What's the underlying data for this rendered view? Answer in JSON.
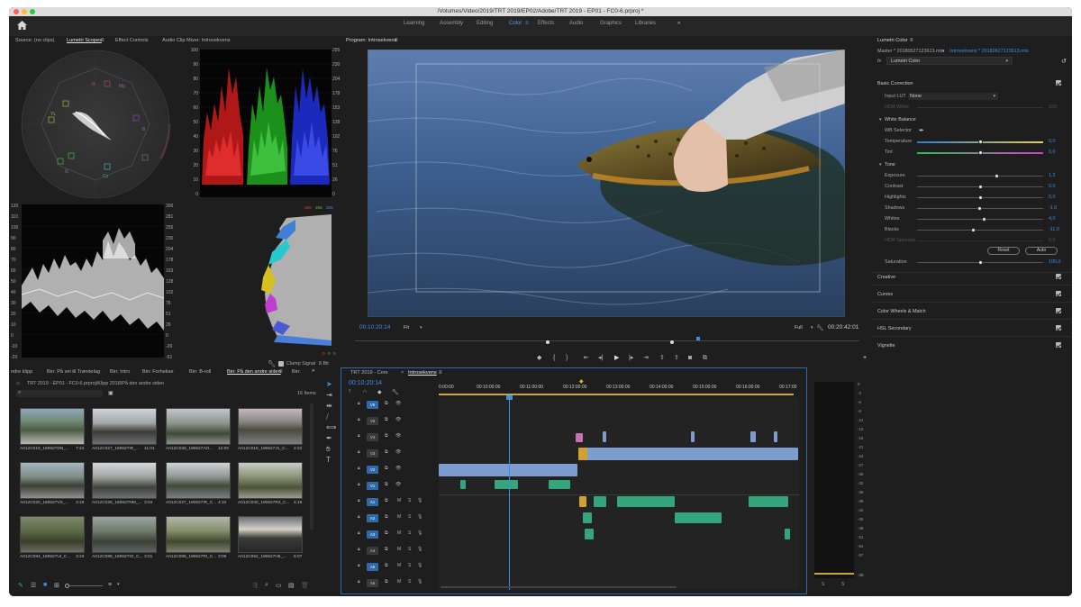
{
  "window": {
    "title": "/Volumes/Video/2019/TRT 2019/EP02/Adobe/TRT 2019 - EP01 - FC0-6.prproj *"
  },
  "workspaces": [
    {
      "label": "Learning",
      "active": false
    },
    {
      "label": "Assembly",
      "active": false
    },
    {
      "label": "Editing",
      "active": false
    },
    {
      "label": "Color",
      "active": true
    },
    {
      "label": "Effects",
      "active": false
    },
    {
      "label": "Audio",
      "active": false
    },
    {
      "label": "Graphics",
      "active": false
    },
    {
      "label": "Libraries",
      "active": false
    }
  ],
  "source_panel": {
    "tabs": [
      "Source: (no clips)",
      "Lumetri Scopes",
      "Effect Controls",
      "Audio Clip Mixer: Introsekvens"
    ],
    "active_tab": "Lumetri Scopes",
    "vectorscope_labels": [
      "R",
      "Mg",
      "B",
      "Cy",
      "G",
      "YL"
    ],
    "parade_scale": [
      "100",
      "90",
      "80",
      "70",
      "60",
      "50",
      "40",
      "30",
      "20",
      "10",
      "0"
    ],
    "parade_right_scale": [
      "255",
      "230",
      "204",
      "178",
      "153",
      "128",
      "102",
      "76",
      "51",
      "26",
      "0"
    ],
    "waveform_scale": [
      "120",
      "110",
      "100",
      "90",
      "80",
      "70",
      "60",
      "50",
      "40",
      "30",
      "20",
      "10",
      "0",
      "-10",
      "-20"
    ],
    "waveform_right_scale": [
      "306",
      "281",
      "255",
      "230",
      "204",
      "178",
      "153",
      "128",
      "102",
      "76",
      "51",
      "26",
      "0",
      "-26",
      "-51"
    ],
    "histogram_counts": [
      "255",
      "255",
      "255"
    ],
    "histogram_bottom": [
      "0",
      "0",
      "0"
    ],
    "clamp_label": "Clamp Signal",
    "bit_depth": "8 Bit"
  },
  "program": {
    "tab": "Program: Introsekvens",
    "timecode": "00:10:20:14",
    "fit": "Fit",
    "quality": "Full",
    "duration": "00:20:42:01"
  },
  "lumetri": {
    "tab": "Lumetri Color",
    "master_clip": "Master * 20180627123613.mts",
    "seq_clip": "Introsekvens * 20180627123613.mts",
    "fx_label": "Lumetri Color",
    "basic_correction": "Basic Correction",
    "input_lut_label": "Input LUT",
    "input_lut_value": "None",
    "hdr_white_label": "HDR White",
    "hdr_white_value": "100",
    "white_balance": "White Balance",
    "wb_selector": "WB Selector",
    "temperature_label": "Temperature",
    "temperature_value": "0,0",
    "tint_label": "Tint",
    "tint_value": "0,0",
    "tone": "Tone",
    "exposure_label": "Exposure",
    "exposure_value": "1,2",
    "contrast_label": "Contrast",
    "contrast_value": "0,0",
    "highlights_label": "Highlights",
    "highlights_value": "0,0",
    "shadows_label": "Shadows",
    "shadows_value": "-1,0",
    "whites_label": "Whites",
    "whites_value": "4,0",
    "blacks_label": "Blacks",
    "blacks_value": "-11,0",
    "hdr_specular_label": "HDR Specular",
    "hdr_specular_value": "0,0",
    "reset_label": "Reset",
    "auto_label": "Auto",
    "saturation_label": "Saturation",
    "saturation_value": "100,0",
    "sections": [
      "Creative",
      "Curves",
      "Color Wheels & Match",
      "HSL Secondary",
      "Vignette"
    ]
  },
  "project": {
    "tabs": [
      "ndre klipp",
      "Bin: På vei til Trøndelag",
      "Bin: Intro",
      "Bin: Forhekse",
      "Bin: B-roll",
      "Bin: På den andre siden",
      "Bin:"
    ],
    "active_tab": "Bin: På den andre siden",
    "path": "TRT 2019 - EP01 - FC0-6.prproj\\Klipp 2018\\På den andre siden",
    "item_count": "16 Items",
    "clips": [
      {
        "name": "A012C019_180627DN_...",
        "dur": "7:24"
      },
      {
        "name": "A012C027_180627IR_...",
        "dur": "11:01"
      },
      {
        "name": "A012C028_180627AO...",
        "dur": "12:00"
      },
      {
        "name": "A012C018_180627J1_C...",
        "dur": "2:22"
      },
      {
        "name": "A012C020_180627VS_...",
        "dur": "3:19"
      },
      {
        "name": "A012C026_180627NM_...",
        "dur": "3:04"
      },
      {
        "name": "A012C027_180627IR_C...",
        "dur": "4:10"
      },
      {
        "name": "A012C030_180627R3_C...",
        "dur": "4:18"
      },
      {
        "name": "A012C084_180627UI_C...",
        "dur": "3:19"
      },
      {
        "name": "A012C089_180627IO_C...",
        "dur": "3:01"
      },
      {
        "name": "A012C086_180627RI_C...",
        "dur": "3:06"
      },
      {
        "name": "A012C062_180627H5_...",
        "dur": "5:07"
      }
    ]
  },
  "timeline": {
    "tabs": [
      "TRT 2019 - Core",
      "Introsekvens"
    ],
    "active_tab": "Introsekvens",
    "timecode": "00:10:20:14",
    "ruler": [
      "0:00:00",
      "00:10:00:00",
      "00:11:00:00",
      "00:12:00:00",
      "00:13:00:00",
      "00:14:00:00",
      "00:15:00:00",
      "00:16:00:00",
      "00:17:00"
    ],
    "video_tracks": [
      "V6",
      "V5",
      "V4",
      "V3",
      "V2",
      "V1"
    ],
    "audio_tracks": [
      "A1",
      "A2",
      "A3",
      "A4",
      "A5",
      "A6"
    ],
    "selected_tracks": [
      "V6",
      "V2",
      "V1",
      "A1",
      "A2",
      "A3",
      "A5"
    ],
    "audio_labels": {
      "mute": "M",
      "solo": "S"
    }
  },
  "meter": {
    "scale": [
      "0",
      "-3",
      "-6",
      "-9",
      "-12",
      "-15",
      "-18",
      "-21",
      "-24",
      "-27",
      "-30",
      "-33",
      "-36",
      "-39",
      "-42",
      "-45",
      "-48",
      "-51",
      "-54",
      "-57",
      "-dB"
    ],
    "channels": [
      "S",
      "S"
    ]
  },
  "icons": {
    "home": "home-icon",
    "wrench": "wrench-icon",
    "play": "play-icon",
    "camera": "camera-icon",
    "selection_tool": "selection-arrow-icon",
    "razor": "razor-icon",
    "hand": "hand-icon",
    "type": "type-icon"
  },
  "colors": {
    "accent": "#3e8fe6",
    "workspace_active": "#5b9bdf",
    "video_clip": "#7d9dd1",
    "audio_clip": "#35a67c",
    "adjust_clip": "#c86fb7"
  }
}
